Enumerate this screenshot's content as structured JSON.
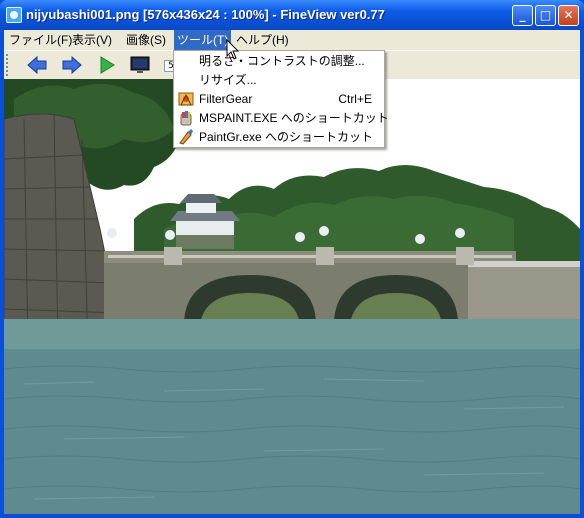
{
  "window": {
    "title": "nijyubashi001.png [576x436x24 : 100%] - FineView ver0.77",
    "controls": {
      "minimize": "_",
      "maximize": "□",
      "close": "✕"
    }
  },
  "menubar": {
    "items": [
      {
        "label": "ファイル(F)"
      },
      {
        "label": "表示(V)"
      },
      {
        "label": "画像(S)"
      },
      {
        "label": "ツール(T)"
      },
      {
        "label": "ヘルプ(H)"
      }
    ],
    "active_index": 3
  },
  "toolbar": {
    "icons": [
      "back-arrow-icon",
      "forward-arrow-icon",
      "play-icon",
      "fullscreen-monitor-icon"
    ],
    "zoom_fragment": "5"
  },
  "tools_menu": {
    "items": [
      {
        "label": "明るさ・コントラストの調整...",
        "shortcut": "",
        "icon": ""
      },
      {
        "label": "リサイズ...",
        "shortcut": "",
        "icon": ""
      },
      {
        "label": "FilterGear",
        "shortcut": "Ctrl+E",
        "icon": "filtergear-icon"
      },
      {
        "label": "MSPAINT.EXE へのショートカット",
        "shortcut": "",
        "icon": "mspaint-icon"
      },
      {
        "label": "PaintGr.exe へのショートカット",
        "shortcut": "",
        "icon": "paintgr-icon"
      }
    ]
  },
  "colors": {
    "titlebar": "#0a50d6",
    "menu_highlight": "#316ac5",
    "chrome": "#ece9d8",
    "sky": "#ffffff",
    "water": "#5f8b8f",
    "foliage": "#2f5a2c"
  }
}
